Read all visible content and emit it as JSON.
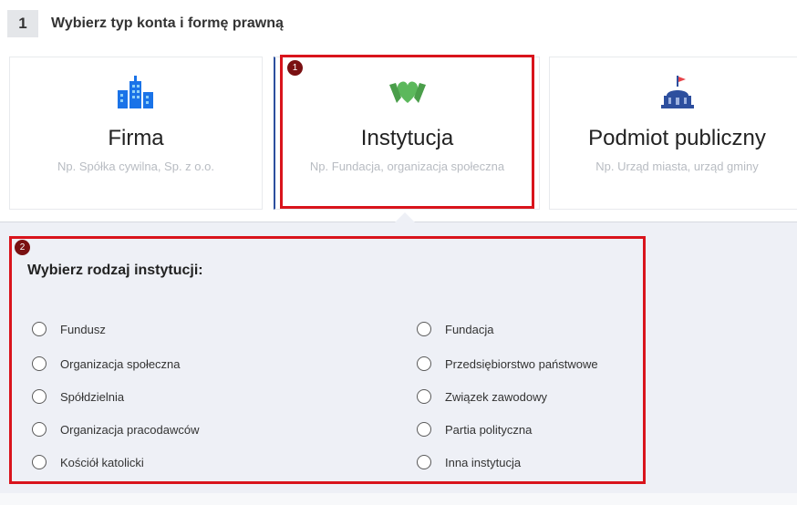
{
  "step": {
    "number": "1",
    "title": "Wybierz typ konta i formę prawną"
  },
  "cards": {
    "firma": {
      "name": "Firma",
      "desc": "Np. Spółka cywilna, Sp. z o.o."
    },
    "instytucja": {
      "name": "Instytucja",
      "desc": "Np. Fundacja, organizacja społeczna"
    },
    "publiczny": {
      "name": "Podmiot publiczny",
      "desc": "Np. Urząd miasta, urząd gminy"
    }
  },
  "badges": {
    "one": "1",
    "two": "2"
  },
  "panel": {
    "title": "Wybierz rodzaj instytucji:",
    "left_options": [
      "Fundusz",
      "Organizacja społeczna",
      "Spółdzielnia",
      "Organizacja pracodawców",
      "Kościół katolicki"
    ],
    "right_options": [
      "Fundacja",
      "Przedsiębiorstwo państwowe",
      "Związek zawodowy",
      "Partia polityczna",
      "Inna instytucja"
    ]
  },
  "colors": {
    "building_icon": "#1a73e8",
    "heart_icon": "#5cb85c",
    "gov_icon": "#2d4f9e",
    "highlight": "#d9141c",
    "badge": "#7a1012"
  },
  "icons": {
    "firma": "buildings-icon",
    "instytucja": "hands-heart-icon",
    "publiczny": "government-building-icon"
  }
}
